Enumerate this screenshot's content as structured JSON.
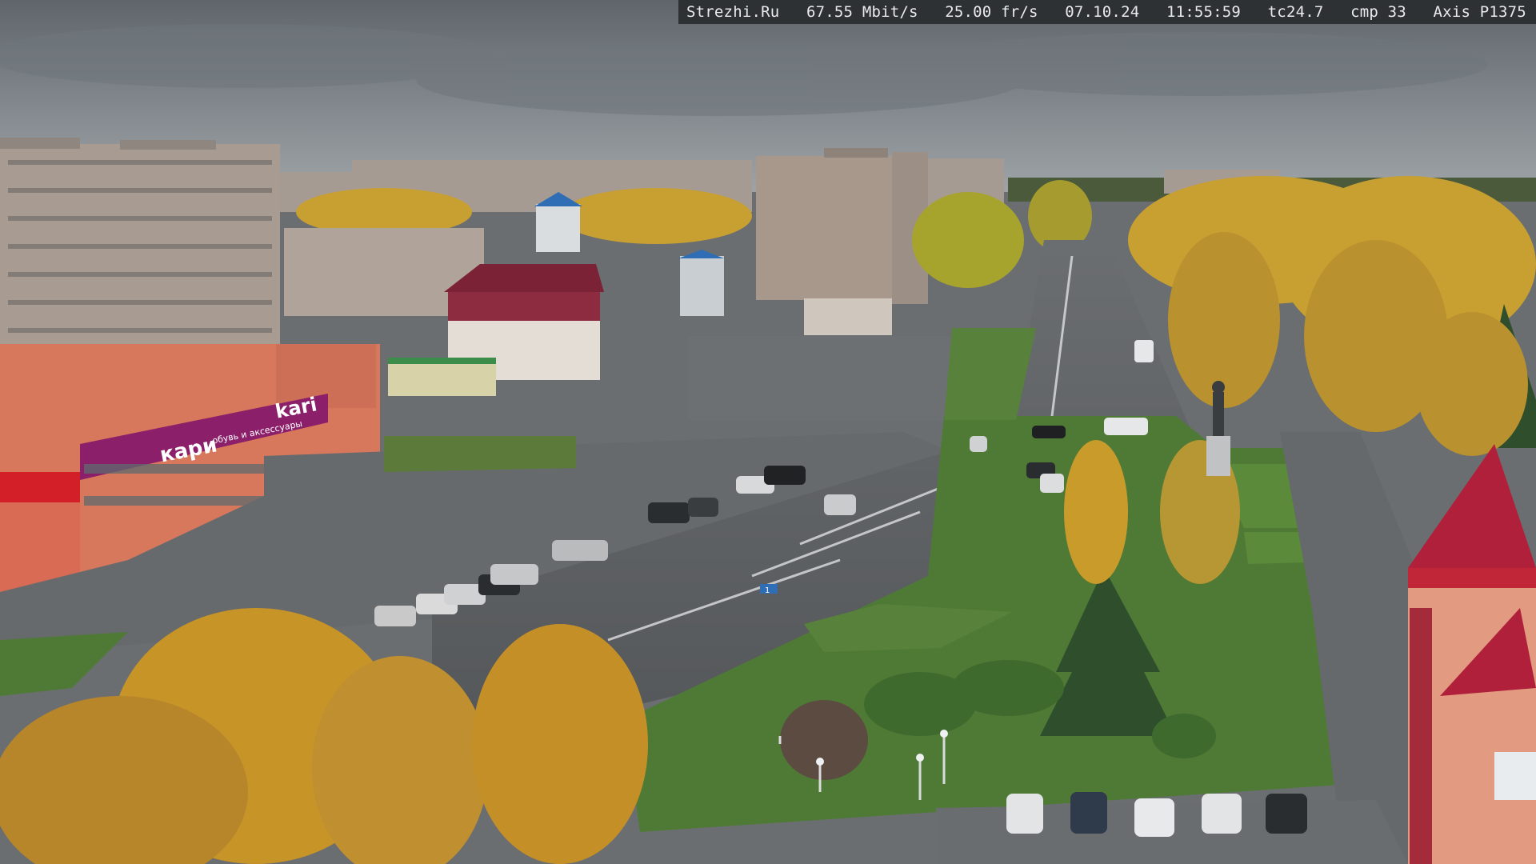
{
  "osd": {
    "site": "Strezhi.Ru",
    "bitrate": "67.55 Mbit/s",
    "framerate": "25.00 fr/s",
    "date": "07.10.24",
    "time": "11:55:59",
    "tc": "tc24.7",
    "cmp": "cmp 33",
    "camera": "Axis P1375"
  },
  "signs": {
    "store_logo": "kari",
    "store_banner": "кари",
    "store_sub": "обувь и аксессуары",
    "road_sign": "1"
  },
  "colors": {
    "sky": "#7f858a",
    "grass": "#4f7a36",
    "autumn": "#c9a030",
    "asphalt": "#5c5f61",
    "kari_magenta": "#8c1f6a",
    "roof_red": "#b0203a"
  }
}
